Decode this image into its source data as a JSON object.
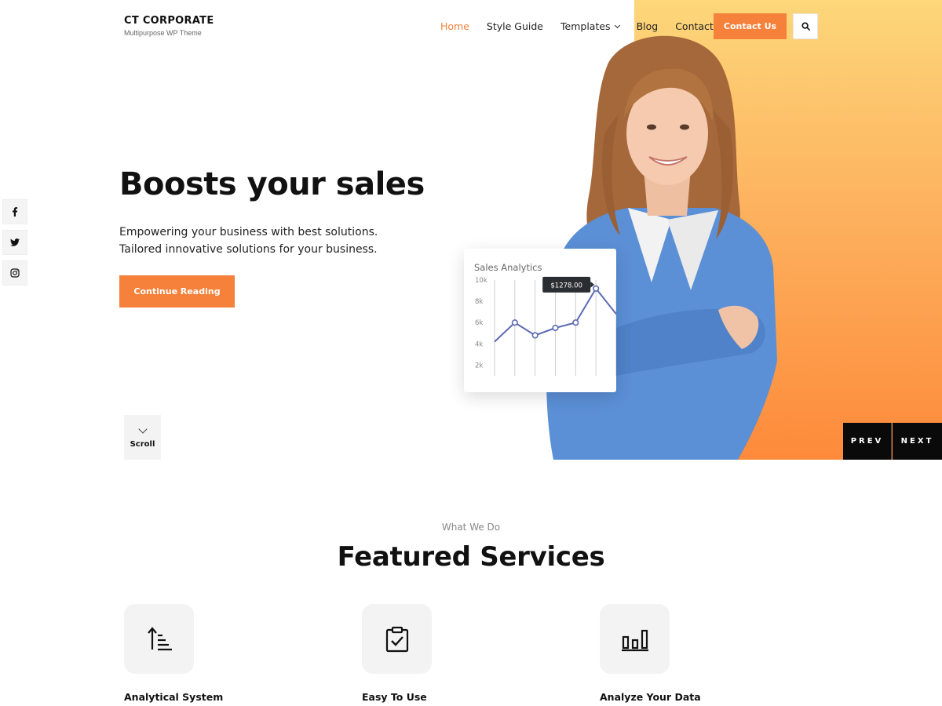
{
  "header": {
    "brand_name": "CT CORPORATE",
    "brand_tagline": "Multipurpose WP Theme",
    "nav": [
      {
        "label": "Home",
        "active": true
      },
      {
        "label": "Style Guide"
      },
      {
        "label": "Templates",
        "has_dropdown": true
      },
      {
        "label": "Blog"
      },
      {
        "label": "Contact"
      }
    ],
    "cta_label": "Contact Us",
    "search_icon": "search-icon"
  },
  "social": [
    "facebook-icon",
    "twitter-icon",
    "instagram-icon"
  ],
  "hero": {
    "title": "Boosts your sales",
    "subtitle_line1": "Empowering your business with best solutions.",
    "subtitle_line2": "Tailored innovative solutions for your business.",
    "button_label": "Continue Reading",
    "scroll_label": "Scroll",
    "prev_label": "PREV",
    "next_label": "NEXT"
  },
  "analytics_card": {
    "title": "Sales Analytics",
    "tooltip": "$1278.00"
  },
  "chart_data": {
    "type": "line",
    "title": "Sales Analytics",
    "xlabel": "",
    "ylabel": "",
    "y_ticks": [
      "10k",
      "8k",
      "6k",
      "4k",
      "2k"
    ],
    "ylim": [
      1000,
      10000
    ],
    "x": [
      0,
      1,
      2,
      3,
      4,
      5,
      6
    ],
    "values": [
      4200,
      6000,
      4800,
      5500,
      6000,
      9200,
      6800
    ],
    "markers_at": [
      1,
      2,
      3,
      4,
      5
    ],
    "highlight_label": "$1278.00",
    "grid": "vertical"
  },
  "services": {
    "eyebrow": "What We Do",
    "title": "Featured Services",
    "items": [
      {
        "label": "Analytical System",
        "icon": "sort-ascending-icon"
      },
      {
        "label": "Easy To Use",
        "icon": "clipboard-check-icon"
      },
      {
        "label": "Analyze Your Data",
        "icon": "bar-chart-icon"
      }
    ]
  },
  "colors": {
    "accent": "#f5813a",
    "gradient_top": "#fdd77a",
    "gradient_bottom": "#fd8a3a",
    "chart_line": "#5b6bb5",
    "dark": "#0a0a0a"
  }
}
